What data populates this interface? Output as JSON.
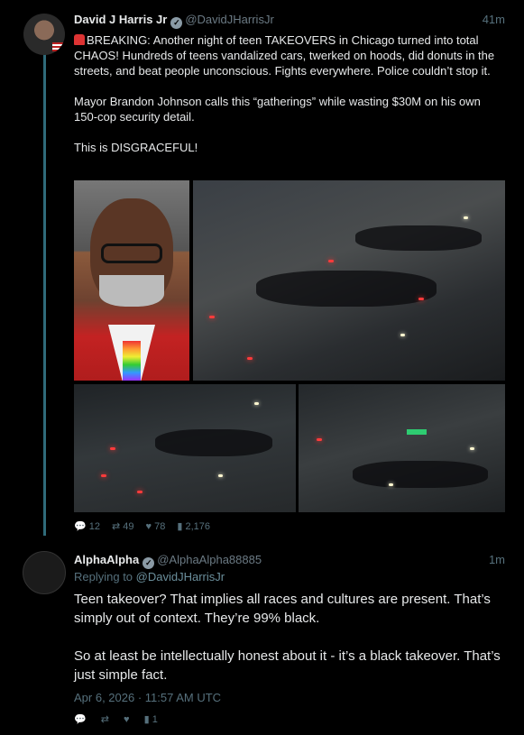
{
  "tweet1": {
    "name": "David J Harris Jr",
    "handle": "@DavidJHarrisJr",
    "time": "41m",
    "paragraphs": [
      "BREAKING: Another night of teen TAKEOVERS in Chicago turned into total CHAOS! Hundreds of teens vandalized cars, twerked on hoods, did donuts in the streets, and beat people unconscious. Fights everywhere. Police couldn’t stop it.",
      "Mayor Brandon Johnson calls this “gatherings” while wasting $30M on his own 150-cop security detail.",
      "This is DISGRACEFUL!"
    ],
    "stats": {
      "replies": "12",
      "retweets": "49",
      "likes": "78",
      "views": "2,176"
    }
  },
  "tweet2": {
    "name": "AlphaAlpha",
    "handle": "@AlphaAlpha88885",
    "time": "1m",
    "replying_label": "Replying to",
    "replying_to": "@DavidJHarrisJr",
    "paragraphs": [
      "Teen takeover?  That implies all races and cultures are present. That’s simply out of context. They’re 99% black.",
      "So at least be intellectually honest about it - it’s a black takeover. That’s just simple fact."
    ],
    "date": "Apr 6, 2026 · 11:57 AM UTC",
    "stats": {
      "views": "1"
    }
  },
  "icons": [
    "reply-icon",
    "retweet-icon",
    "like-icon",
    "views-icon",
    "verified-icon",
    "siren-icon"
  ],
  "colors": {
    "background": "#000000",
    "text": "#e7e9ea",
    "muted": "#56707c",
    "thread_line": "#2f6b7a"
  }
}
